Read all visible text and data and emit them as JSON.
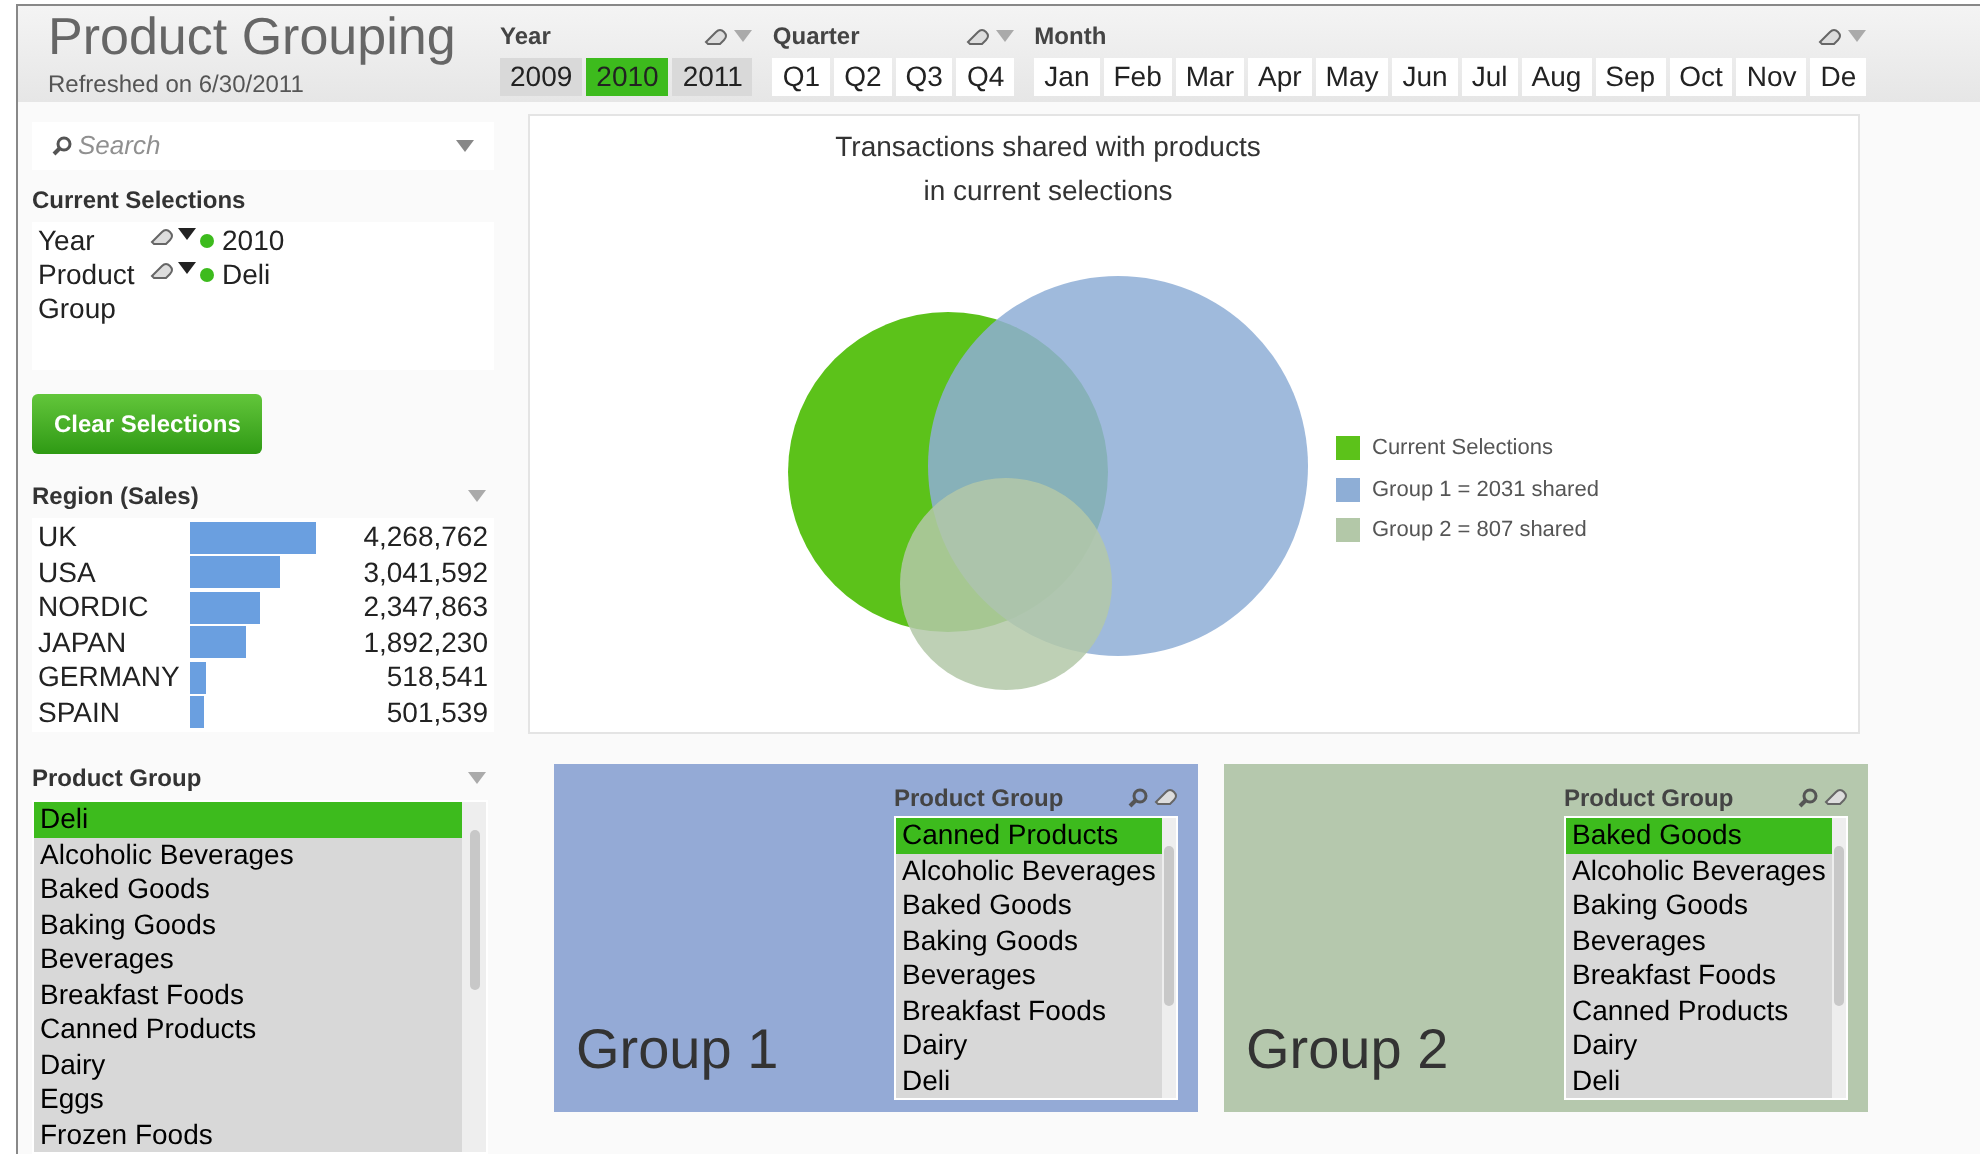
{
  "header": {
    "title": "Product Grouping",
    "subtitle": "Refreshed on 6/30/2011"
  },
  "filters": [
    {
      "label": "Year",
      "options": [
        {
          "label": "2009",
          "selected": false,
          "excluded": true
        },
        {
          "label": "2010",
          "selected": true,
          "excluded": false
        },
        {
          "label": "2011",
          "selected": false,
          "excluded": true
        }
      ]
    },
    {
      "label": "Quarter",
      "options": [
        {
          "label": "Q1",
          "selected": false,
          "excluded": false
        },
        {
          "label": "Q2",
          "selected": false,
          "excluded": false
        },
        {
          "label": "Q3",
          "selected": false,
          "excluded": false
        },
        {
          "label": "Q4",
          "selected": false,
          "excluded": false
        }
      ]
    },
    {
      "label": "Month",
      "options": [
        {
          "label": "Jan",
          "selected": false,
          "excluded": false
        },
        {
          "label": "Feb",
          "selected": false,
          "excluded": false
        },
        {
          "label": "Mar",
          "selected": false,
          "excluded": false
        },
        {
          "label": "Apr",
          "selected": false,
          "excluded": false
        },
        {
          "label": "May",
          "selected": false,
          "excluded": false
        },
        {
          "label": "Jun",
          "selected": false,
          "excluded": false
        },
        {
          "label": "Jul",
          "selected": false,
          "excluded": false
        },
        {
          "label": "Aug",
          "selected": false,
          "excluded": false
        },
        {
          "label": "Sep",
          "selected": false,
          "excluded": false
        },
        {
          "label": "Oct",
          "selected": false,
          "excluded": false
        },
        {
          "label": "Nov",
          "selected": false,
          "excluded": false
        },
        {
          "label": "De",
          "selected": false,
          "excluded": false
        }
      ]
    }
  ],
  "search": {
    "placeholder": "Search"
  },
  "current_selections": {
    "title": "Current Selections",
    "items": [
      {
        "field": "Year",
        "value": "2010"
      },
      {
        "field": "Product Group",
        "value": "Deli"
      }
    ]
  },
  "clear_button": "Clear Selections",
  "region_sales": {
    "title": "Region (Sales)",
    "rows": [
      {
        "name": "UK",
        "value": "4,268,762"
      },
      {
        "name": "USA",
        "value": "3,041,592"
      },
      {
        "name": "NORDIC",
        "value": "2,347,863"
      },
      {
        "name": "JAPAN",
        "value": "1,892,230"
      },
      {
        "name": "GERMANY",
        "value": "518,541"
      },
      {
        "name": "SPAIN",
        "value": "501,539"
      }
    ]
  },
  "product_group": {
    "title": "Product Group",
    "items": [
      {
        "label": "Deli",
        "selected": true
      },
      {
        "label": "Alcoholic Beverages",
        "selected": false
      },
      {
        "label": "Baked Goods",
        "selected": false
      },
      {
        "label": "Baking Goods",
        "selected": false
      },
      {
        "label": "Beverages",
        "selected": false
      },
      {
        "label": "Breakfast Foods",
        "selected": false
      },
      {
        "label": "Canned Products",
        "selected": false
      },
      {
        "label": "Dairy",
        "selected": false
      },
      {
        "label": "Eggs",
        "selected": false
      },
      {
        "label": "Frozen Foods",
        "selected": false
      }
    ]
  },
  "venn": {
    "title_lines": [
      "Transactions shared with products",
      "in current selections"
    ],
    "legend": [
      {
        "label": "Current Selections",
        "color": "#5cc21a"
      },
      {
        "label": "Group 1 = 2031 shared",
        "color": "#8eaed6"
      },
      {
        "label": "Group 2 = 807 shared",
        "color": "#b3c8a8"
      }
    ]
  },
  "groups": [
    {
      "name": "Group 1",
      "color": "#94aad6",
      "list_title": "Product Group",
      "items": [
        {
          "label": "Canned Products",
          "selected": true
        },
        {
          "label": "Alcoholic Beverages",
          "selected": false
        },
        {
          "label": "Baked Goods",
          "selected": false
        },
        {
          "label": "Baking Goods",
          "selected": false
        },
        {
          "label": "Beverages",
          "selected": false
        },
        {
          "label": "Breakfast Foods",
          "selected": false
        },
        {
          "label": "Dairy",
          "selected": false
        },
        {
          "label": "Deli",
          "selected": false
        }
      ]
    },
    {
      "name": "Group 2",
      "color": "#b5c8ad",
      "list_title": "Product Group",
      "items": [
        {
          "label": "Baked Goods",
          "selected": true
        },
        {
          "label": "Alcoholic Beverages",
          "selected": false
        },
        {
          "label": "Baking Goods",
          "selected": false
        },
        {
          "label": "Beverages",
          "selected": false
        },
        {
          "label": "Breakfast Foods",
          "selected": false
        },
        {
          "label": "Canned Products",
          "selected": false
        },
        {
          "label": "Dairy",
          "selected": false
        },
        {
          "label": "Deli",
          "selected": false
        }
      ]
    }
  ]
}
